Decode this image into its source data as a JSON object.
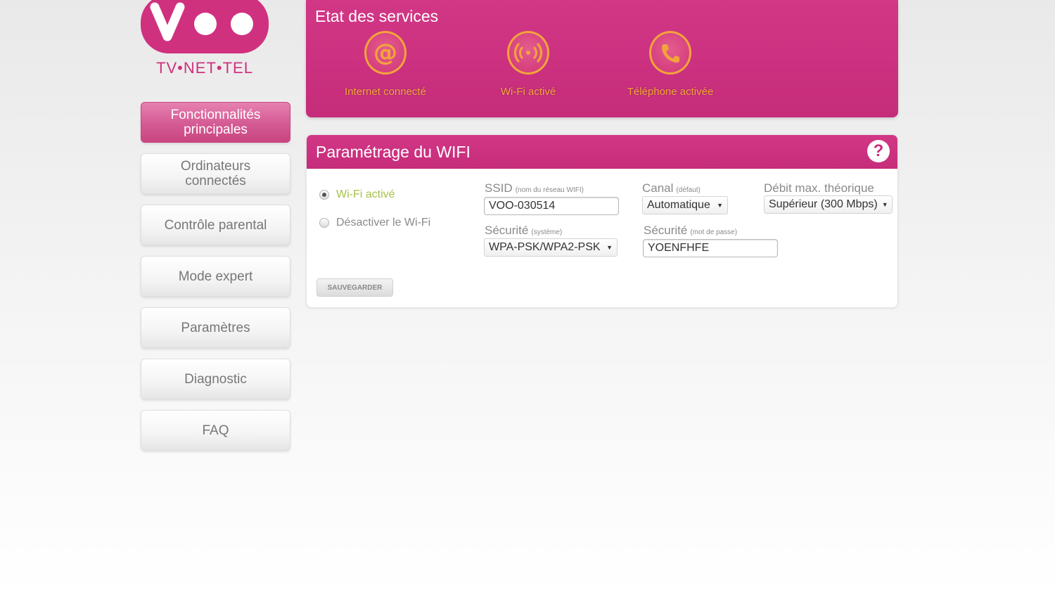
{
  "logo": {
    "tagline": "TV•NET•TEL",
    "brand_color": "#d0317f"
  },
  "sidebar": {
    "items": [
      {
        "label": "Fonctionnalités principales",
        "active": true
      },
      {
        "label": "Ordinateurs connectés",
        "active": false
      },
      {
        "label": "Contrôle parental",
        "active": false
      },
      {
        "label": "Mode expert",
        "active": false
      },
      {
        "label": "Paramètres",
        "active": false
      },
      {
        "label": "Diagnostic",
        "active": false
      },
      {
        "label": "FAQ",
        "active": false
      }
    ]
  },
  "services": {
    "title": "Etat des services",
    "items": [
      {
        "label": "Internet connecté",
        "icon": "at-sign-icon"
      },
      {
        "label": "Wi-Fi activé",
        "icon": "wifi-signal-icon"
      },
      {
        "label": "Téléphone activée",
        "icon": "phone-icon"
      }
    ],
    "status_color": "#f2a43a"
  },
  "wifi": {
    "title": "Paramétrage du WIFI",
    "help_label": "?",
    "radio_on_label": "Wi-Fi activé",
    "radio_off_label": "Désactiver le Wi-Fi",
    "wifi_enabled": true,
    "ssid_label": "SSID",
    "ssid_hint": "(nom du réseau WIFI)",
    "ssid_value": "VOO-030514",
    "security_label": "Sécurité",
    "security_hint": "(système)",
    "security_value": "WPA-PSK/WPA2-PSK",
    "channel_label": "Canal",
    "channel_hint": "(défaut)",
    "channel_value": "Automatique",
    "password_label": "Sécurité",
    "password_hint": "(mot de passe)",
    "password_value": "YOENFHFE",
    "rate_label": "Débit max. théorique",
    "rate_value": "Supérieur (300 Mbps)",
    "save_label": "SAUVEGARDER"
  },
  "colors": {
    "accent": "#c8307c",
    "enabled_green": "#a6c24a"
  }
}
